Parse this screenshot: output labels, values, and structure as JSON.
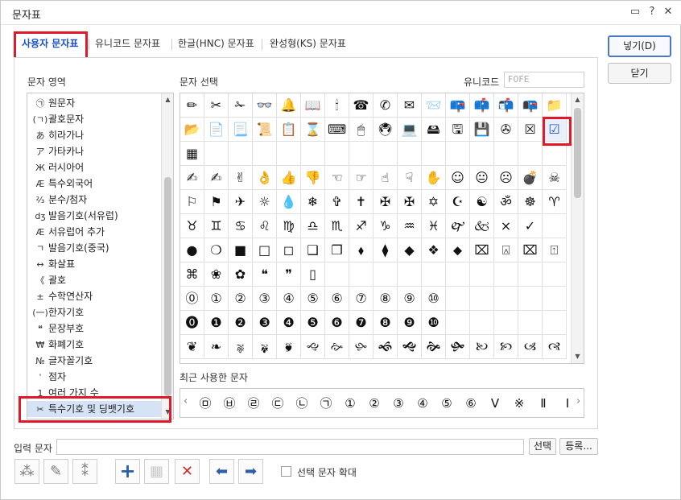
{
  "window": {
    "title": "문자표",
    "title_icons": [
      "chat-icon",
      "help-icon",
      "close-icon"
    ],
    "title_glyphs": [
      "▭",
      "?",
      "✕"
    ]
  },
  "tabs": [
    {
      "label": "사용자 문자표",
      "active": true
    },
    {
      "label": "유니코드 문자표",
      "active": false
    },
    {
      "label": "한글(HNC) 문자표",
      "active": false
    },
    {
      "label": "완성형(KS) 문자표",
      "active": false
    }
  ],
  "labels": {
    "char_area": "문자 영역",
    "char_select": "문자 선택",
    "unicode": "유니코드",
    "unicode_value": "F0FE",
    "recent": "최근 사용한 문자",
    "input": "입력 문자",
    "enlarge": "선택 문자 확대"
  },
  "categories": [
    {
      "icon": "㉠",
      "label": "원문자"
    },
    {
      "icon": "(ㄱ)",
      "label": "괄호문자"
    },
    {
      "icon": "あ",
      "label": "히라가나"
    },
    {
      "icon": "ア",
      "label": "가타카나"
    },
    {
      "icon": "Ж",
      "label": "러시아어"
    },
    {
      "icon": "Æ",
      "label": "특수외국어"
    },
    {
      "icon": "⅔",
      "label": "분수/첨자"
    },
    {
      "icon": "dʒ",
      "label": "발음기호(서유럽)"
    },
    {
      "icon": "Æ",
      "label": "서유럽어 추가"
    },
    {
      "icon": "ㄱ",
      "label": "발음기호(중국)"
    },
    {
      "icon": "↔",
      "label": "화살표"
    },
    {
      "icon": "《",
      "label": "괄호"
    },
    {
      "icon": "±",
      "label": "수학연산자"
    },
    {
      "icon": "(一)",
      "label": "한자기호"
    },
    {
      "icon": "❝",
      "label": "문장부호"
    },
    {
      "icon": "₩",
      "label": "화폐기호"
    },
    {
      "icon": "№",
      "label": "글자꼴기호"
    },
    {
      "icon": "ˈ",
      "label": "점자"
    },
    {
      "icon": "1",
      "label": "여러 가지 수"
    },
    {
      "icon": "✂",
      "label": "특수기호 및 딩뱃기호",
      "selected": true
    }
  ],
  "char_rows": [
    [
      "✏",
      "✂",
      "✁",
      "👓",
      "🔔",
      "📖",
      "🕯",
      "☎",
      "✆",
      "✉",
      "📨",
      "📪",
      "📫",
      "📬",
      "📭",
      "📁"
    ],
    [
      "📂",
      "📄",
      "📃",
      "📜",
      "📋",
      "⌛",
      "⌨",
      "🖱",
      "🖲",
      "💻",
      "🖴",
      "🖫",
      "💾",
      "✇",
      "☒",
      "☑"
    ],
    [
      "▦",
      "",
      "",
      "",
      "",
      "",
      "",
      "",
      "",
      "",
      "",
      "",
      "",
      "",
      "",
      ""
    ],
    [
      "✍",
      "✍",
      "✌",
      "👌",
      "👍",
      "👎",
      "☜",
      "☞",
      "☝",
      "☟",
      "✋",
      "☺",
      "😐",
      "☹",
      "💣",
      "☠"
    ],
    [
      "⚐",
      "⚑",
      "✈",
      "☼",
      "💧",
      "❄",
      "✞",
      "✝",
      "✠",
      "✠",
      "✡",
      "☪",
      "☯",
      "ॐ",
      "☸",
      "♈"
    ],
    [
      "♉",
      "♊",
      "♋",
      "♌",
      "♍",
      "♎",
      "♏",
      "♐",
      "♑",
      "♒",
      "♓",
      "🙰",
      "🙵",
      "×",
      "✓",
      ""
    ],
    [
      "●",
      "❍",
      "■",
      "□",
      "◻",
      "❑",
      "❒",
      "⬧",
      "⧫",
      "◆",
      "❖",
      "⬥",
      "⌧",
      "⍓",
      "⌧",
      "⍐"
    ],
    [
      "⌘",
      "❀",
      "✿",
      "❝",
      "❞",
      "▯",
      "",
      "",
      "",
      "",
      "",
      "",
      "",
      "",
      "",
      ""
    ],
    [
      "⓪",
      "①",
      "②",
      "③",
      "④",
      "⑤",
      "⑥",
      "⑦",
      "⑧",
      "⑨",
      "⑩",
      "",
      "",
      "",
      "",
      ""
    ],
    [
      "⓿",
      "❶",
      "❷",
      "❸",
      "❹",
      "❺",
      "❻",
      "❼",
      "❽",
      "❾",
      "❿",
      "",
      "",
      "",
      "",
      ""
    ],
    [
      "❦",
      "❧",
      "🙖",
      "🙗",
      "🙘",
      "🙙",
      "🙚",
      "🙛",
      "🙜",
      "🙝",
      "🙞",
      "🙟",
      "🙠",
      "🙡",
      "🙢",
      "🙣"
    ]
  ],
  "recent_chars": [
    "㉤",
    "㉥",
    "㉣",
    "㉢",
    "㉡",
    "㉠",
    "①",
    "②",
    "③",
    "④",
    "⑤",
    "⑥",
    "Ⅴ",
    "※",
    "Ⅱ",
    "Ⅰ"
  ],
  "buttons": {
    "insert": "넣기(D)",
    "close": "닫기",
    "select": "선택",
    "register": "등록..."
  },
  "tools": [
    {
      "icon": "add-user-chars-icon",
      "glyph": "⁂"
    },
    {
      "icon": "edit-user-chars-icon",
      "glyph": "✎"
    },
    {
      "icon": "delete-user-chars-icon",
      "glyph": "⁑"
    },
    {
      "icon": "plus-icon",
      "glyph": "+"
    },
    {
      "icon": "grid-add-icon",
      "glyph": "▦",
      "disabled": true
    },
    {
      "icon": "delete-x-icon",
      "glyph": "✕"
    },
    {
      "icon": "arrow-left-icon",
      "glyph": "⬅"
    },
    {
      "icon": "arrow-right-icon",
      "glyph": "➡"
    }
  ],
  "colors": {
    "accent": "#1a52c9",
    "highlight": "#e11a2b",
    "selected_row": "#d6e3f7",
    "tool_blue": "#2a5ea8",
    "tool_red": "#d42b2b"
  }
}
